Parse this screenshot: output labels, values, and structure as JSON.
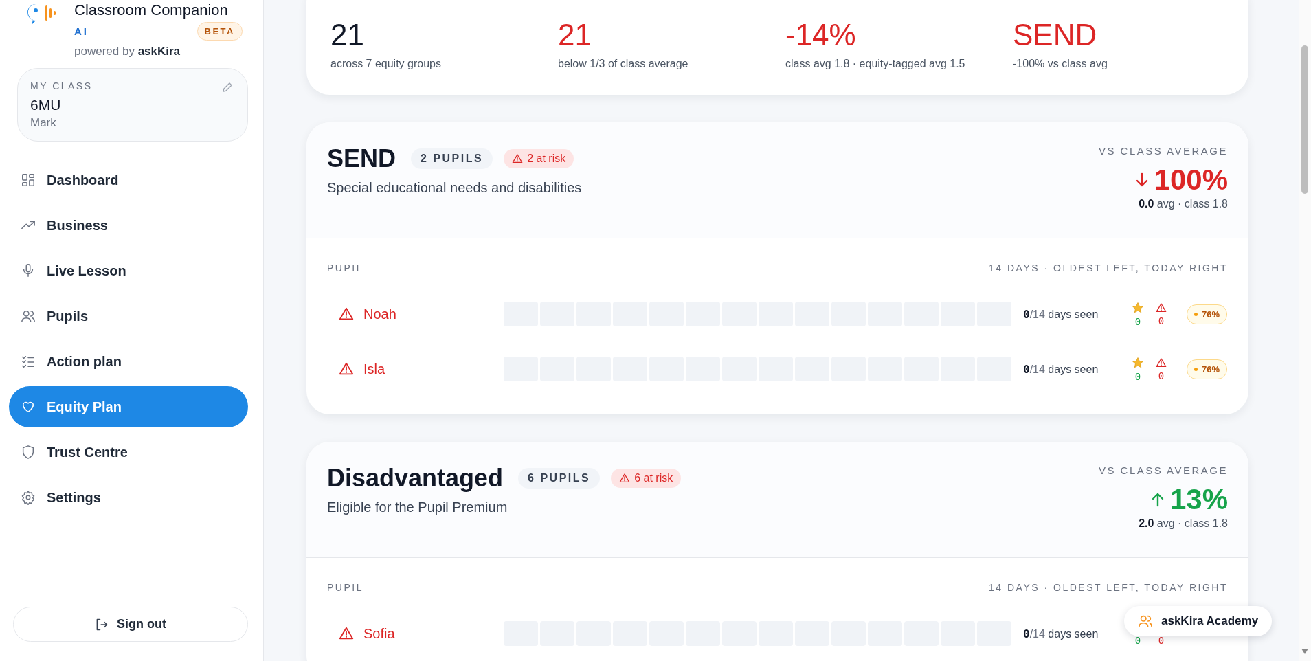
{
  "sidebar": {
    "brand": {
      "title": "Classroom Companion",
      "subtitle": "AI",
      "badge": "BETA",
      "powered_by": "powered by **askKira**"
    },
    "my_class": {
      "label": "MY CLASS",
      "class_name": "6MU",
      "teacher": "Mark"
    },
    "nav": [
      {
        "label": "Dashboard",
        "selected": false
      },
      {
        "label": "Business",
        "selected": false
      },
      {
        "label": "Live Lesson",
        "selected": false
      },
      {
        "label": "Pupils",
        "selected": false
      },
      {
        "label": "Action plan",
        "selected": false
      },
      {
        "label": "Equity Plan",
        "selected": true
      },
      {
        "label": "Trust Centre",
        "selected": false
      },
      {
        "label": "Settings",
        "selected": false
      }
    ],
    "sign_out": "Sign out"
  },
  "stats": [
    {
      "value": "21",
      "note": "across 7 equity groups",
      "alert": false
    },
    {
      "value": "21",
      "note": "below 1/3 of class average",
      "alert": true
    },
    {
      "value": "-14%",
      "note": "class avg 1.8 · equity-tagged avg 1.5",
      "alert": true
    },
    {
      "value": "SEND",
      "note": "-100% vs class avg",
      "alert": true
    }
  ],
  "groups": [
    {
      "title": "SEND",
      "pupil_count": "2 PUPILS",
      "at_risk": "2 at risk",
      "description": "Special educational needs and disabilities",
      "compare_label": "VS CLASS AVERAGE",
      "rising": false,
      "change": "100%",
      "avg": "**0.0** avg · class 1.8",
      "column_pupil": "PUPIL",
      "column_days": "14 DAYS · OLDEST LEFT, TODAY RIGHT",
      "pupils": [
        {
          "name": "Noah",
          "at_risk": true,
          "days": [
            {
              "seen": false
            },
            {
              "seen": false
            },
            {
              "seen": false
            },
            {
              "seen": false
            },
            {
              "seen": false
            },
            {
              "seen": false
            },
            {
              "seen": false
            },
            {
              "seen": false
            },
            {
              "seen": false
            },
            {
              "seen": false
            },
            {
              "seen": false
            },
            {
              "seen": false
            },
            {
              "seen": false
            },
            {
              "seen": false
            }
          ],
          "seen_count": "0",
          "seen_total": "/14",
          "seen_label": "days seen",
          "star_count": "0",
          "warning_count": "0",
          "badge": "76%"
        },
        {
          "name": "Isla",
          "at_risk": true,
          "days": [
            {
              "seen": false
            },
            {
              "seen": false
            },
            {
              "seen": false
            },
            {
              "seen": false
            },
            {
              "seen": false
            },
            {
              "seen": false
            },
            {
              "seen": false
            },
            {
              "seen": false
            },
            {
              "seen": false
            },
            {
              "seen": false
            },
            {
              "seen": false
            },
            {
              "seen": false
            },
            {
              "seen": false
            },
            {
              "seen": false
            }
          ],
          "seen_count": "0",
          "seen_total": "/14",
          "seen_label": "days seen",
          "star_count": "0",
          "warning_count": "0",
          "badge": "76%"
        }
      ]
    },
    {
      "title": "Disadvantaged",
      "pupil_count": "6 PUPILS",
      "at_risk": "6 at risk",
      "description": "Eligible for the Pupil Premium",
      "compare_label": "VS CLASS AVERAGE",
      "rising": true,
      "change": "13%",
      "avg": "**2.0** avg · class 1.8",
      "column_pupil": "PUPIL",
      "column_days": "14 DAYS · OLDEST LEFT, TODAY RIGHT",
      "pupils": [
        {
          "name": "Sofia",
          "at_risk": true,
          "days": [
            {
              "seen": false
            },
            {
              "seen": false
            },
            {
              "seen": false
            },
            {
              "seen": false
            },
            {
              "seen": false
            },
            {
              "seen": false
            },
            {
              "seen": false
            },
            {
              "seen": false
            },
            {
              "seen": false
            },
            {
              "seen": false
            },
            {
              "seen": false
            },
            {
              "seen": false
            },
            {
              "seen": false
            },
            {
              "seen": false
            }
          ],
          "seen_count": "0",
          "seen_total": "/14",
          "seen_label": "days seen",
          "star_count": "0",
          "warning_count": "0"
        }
      ]
    }
  ],
  "academy_button": "askKira Academy"
}
